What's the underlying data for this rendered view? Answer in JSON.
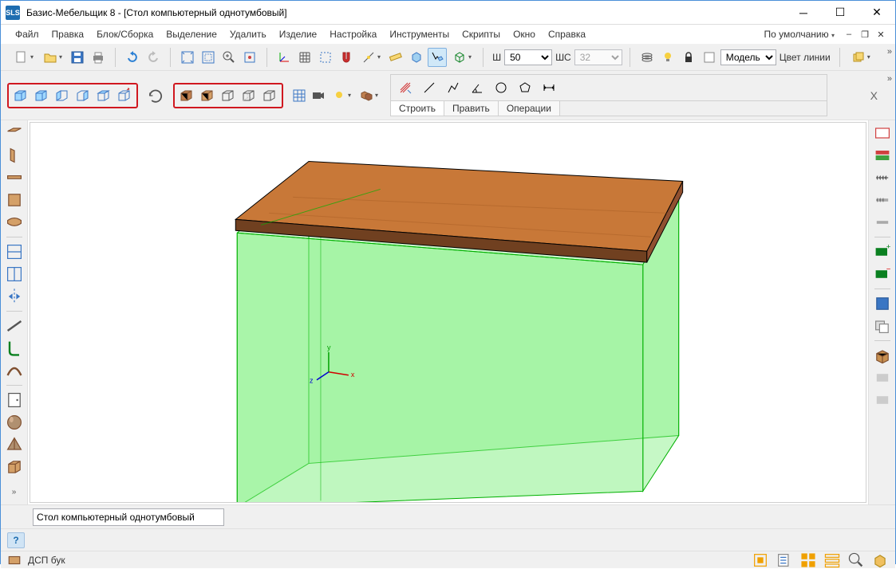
{
  "titlebar": {
    "app_prefix": "SLS",
    "title": "Базис-Мебельщик 8 - [Стол компьютерный однотумбовый]"
  },
  "menu": {
    "items": [
      "Файл",
      "Правка",
      "Блок/Сборка",
      "Выделение",
      "Удалить",
      "Изделие",
      "Настройка",
      "Инструменты",
      "Скрипты",
      "Окно",
      "Справка"
    ],
    "layout_label": "По умолчанию"
  },
  "toolbar": {
    "w_label": "Ш",
    "w_value": "50",
    "ws_label": "ШС",
    "ws_value": "32",
    "mode_label": "Модель",
    "line_color_label": "Цвет линии"
  },
  "ribbon": {
    "axis_label": "X",
    "tabs": [
      "Строить",
      "Править",
      "Операции"
    ]
  },
  "object_name": "Стол компьютерный однотумбовый",
  "status": {
    "material": "ДСП бук"
  }
}
